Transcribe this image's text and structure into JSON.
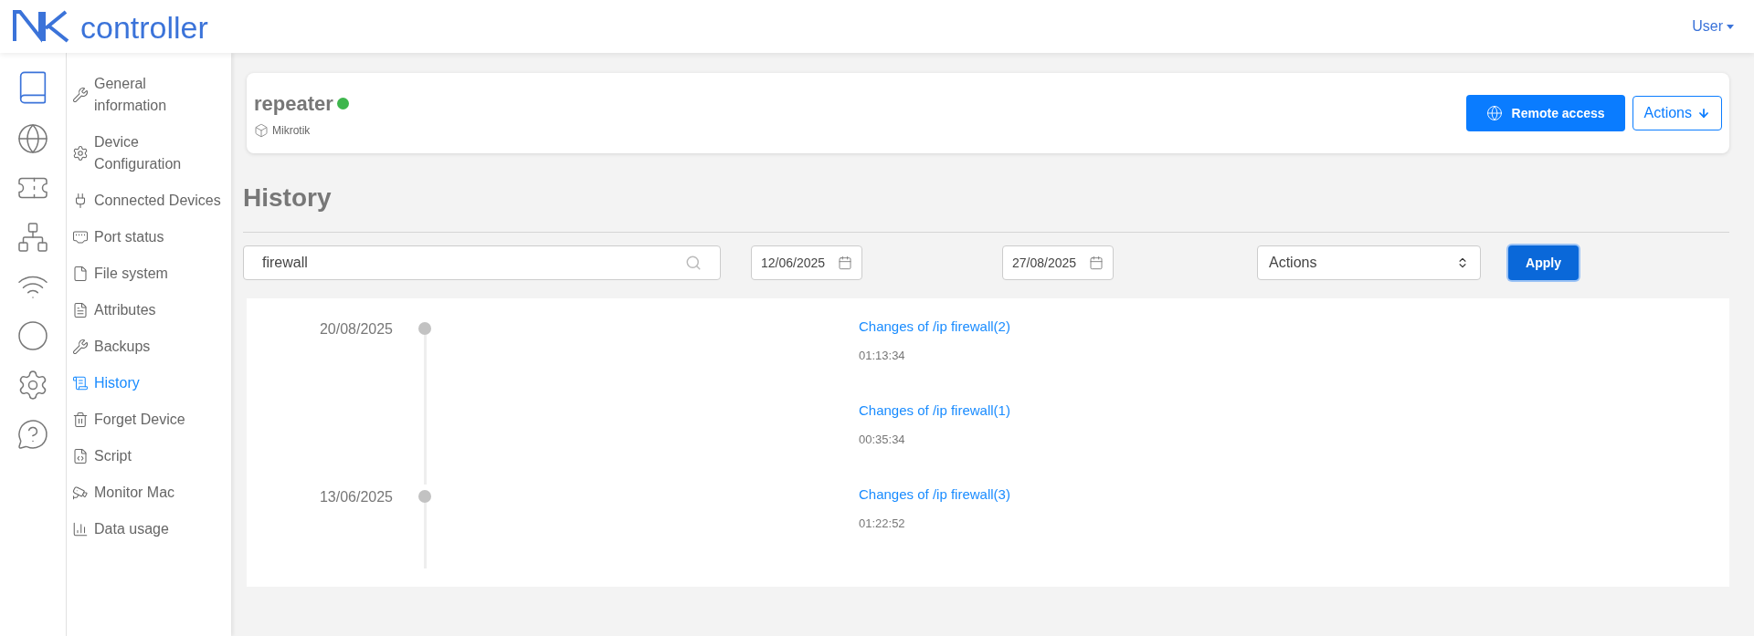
{
  "header": {
    "logo_text": "controller",
    "user_menu": "User"
  },
  "sidebar": {
    "items": [
      {
        "label": "General information",
        "selected": false
      },
      {
        "label": "Device Configuration",
        "selected": false
      },
      {
        "label": "Connected Devices",
        "selected": false
      },
      {
        "label": "Port status",
        "selected": false
      },
      {
        "label": "File system",
        "selected": false
      },
      {
        "label": "Attributes",
        "selected": false
      },
      {
        "label": "Backups",
        "selected": false
      },
      {
        "label": "History",
        "selected": true
      },
      {
        "label": "Forget Device",
        "selected": false
      },
      {
        "label": "Script",
        "selected": false
      },
      {
        "label": "Monitor Mac",
        "selected": false
      },
      {
        "label": "Data usage",
        "selected": false
      }
    ]
  },
  "device": {
    "name": "repeater",
    "online": true,
    "vendor": "Mikrotik",
    "buttons": {
      "remote_access": "Remote access",
      "actions": "Actions"
    }
  },
  "page_title": "History",
  "filters": {
    "search": "firewall",
    "date_from": "12/06/2025",
    "date_to": "27/08/2025",
    "action_select": "Actions",
    "apply": "Apply"
  },
  "timeline": [
    {
      "date": "20/08/2025",
      "events": [
        {
          "title": "Changes of /ip firewall(2)",
          "time": "01:13:34"
        },
        {
          "title": "Changes of /ip firewall(1)",
          "time": "00:35:34"
        }
      ]
    },
    {
      "date": "13/06/2025",
      "events": [
        {
          "title": "Changes of /ip firewall(3)",
          "time": "01:22:52"
        }
      ]
    }
  ]
}
